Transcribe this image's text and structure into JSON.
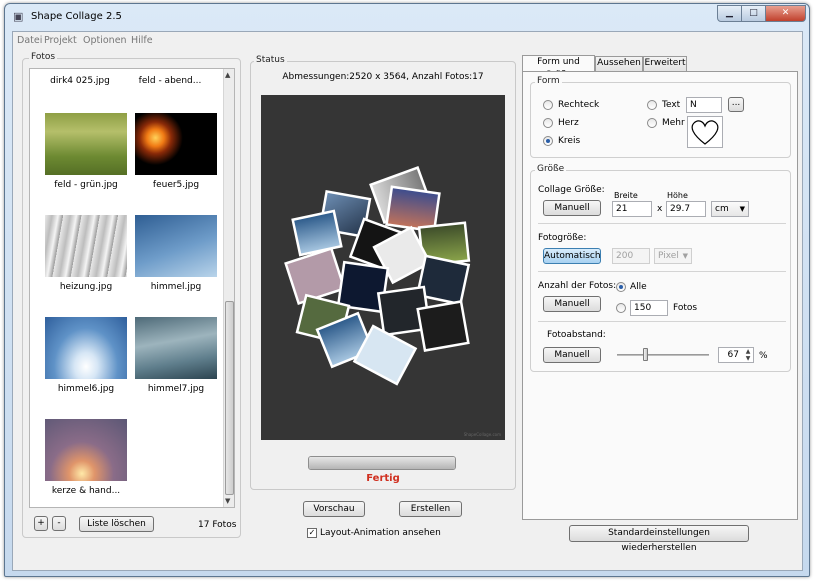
{
  "window": {
    "title": "Shape Collage 2.5"
  },
  "menu": [
    "Datei",
    "Projekt",
    "Optionen",
    "Hilfe"
  ],
  "photos": {
    "group_label": "Fotos",
    "items": [
      {
        "name": "dirk4 025.jpg",
        "thumb": "none"
      },
      {
        "name": "feld - abend...",
        "thumb": "none"
      },
      {
        "name": "feld - grün.jpg",
        "thumb": "field"
      },
      {
        "name": "feuer5.jpg",
        "thumb": "fire"
      },
      {
        "name": "heizung.jpg",
        "thumb": "radiator"
      },
      {
        "name": "himmel.jpg",
        "thumb": "sky"
      },
      {
        "name": "himmel6.jpg",
        "thumb": "sky-sun"
      },
      {
        "name": "himmel7.jpg",
        "thumb": "clouds"
      },
      {
        "name": "kerze & hand...",
        "thumb": "candle"
      }
    ],
    "add_label": "+",
    "remove_label": "-",
    "clear_label": "Liste löschen",
    "count": "17 Fotos"
  },
  "status": {
    "group_label": "Status",
    "dimensions": "Abmessungen:2520 x 3564, Anzahl Fotos:17",
    "progress_fraction": 1.0,
    "state": "Fertig",
    "preview_label": "Vorschau",
    "create_label": "Erstellen",
    "animation_label": "Layout-Animation ansehen",
    "animation_checked": true
  },
  "tabs": [
    "Form und Größe",
    "Aussehen",
    "Erweitert"
  ],
  "form": {
    "group_label": "Form",
    "options": [
      {
        "label": "Rechteck",
        "checked": false
      },
      {
        "label": "Herz",
        "checked": false
      },
      {
        "label": "Kreis",
        "checked": true
      },
      {
        "label": "Text",
        "checked": false
      },
      {
        "label": "Mehr",
        "checked": false
      }
    ],
    "text_value": "N",
    "browse_label": "..."
  },
  "size": {
    "group_label": "Größe",
    "collage_label": "Collage Größe:",
    "collage_button": "Manuell",
    "width_label": "Breite",
    "height_label": "Höhe",
    "width_value": "21",
    "x_label": "x",
    "height_value": "29.7",
    "unit": "cm",
    "photo_size_label": "Fotogröße:",
    "photo_size_button": "Automatisch",
    "photo_size_value": "200",
    "photo_size_unit": "Pixel",
    "count_label": "Anzahl der Fotos:",
    "count_button": "Manuell",
    "all_label": "Alle",
    "all_checked": true,
    "count_value": "150",
    "count_unit": "Fotos",
    "spacing_label": "Fotoabstand:",
    "spacing_button": "Manuell",
    "spacing_value": "67",
    "spacing_percent": 67,
    "spacing_unit": "%"
  },
  "reset_label": "Standardeinstellungen wiederherstellen",
  "colors": {
    "accent": "#3c7fb1",
    "status": "#d03020",
    "preview_bg": "#333333"
  }
}
